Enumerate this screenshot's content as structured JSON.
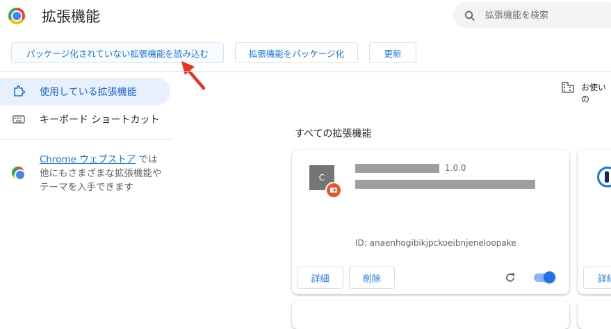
{
  "header": {
    "title": "拡張機能",
    "search_placeholder": "拡張機能を検索"
  },
  "toolbar": {
    "load_unpacked_label": "パッケージ化されていない拡張機能を読み込む",
    "pack_label": "拡張機能をパッケージ化",
    "update_label": "更新"
  },
  "sidebar": {
    "items": [
      {
        "label": "使用している拡張機能",
        "icon": "puzzle-icon",
        "active": true
      },
      {
        "label": "キーボード ショートカット",
        "icon": "keyboard-icon",
        "active": false
      }
    ],
    "store_link": "Chrome ウェブストア",
    "store_suffix": " では他にもさまざまな拡張機能やテーマを入手できます"
  },
  "main": {
    "enterprise_label": "お使いの",
    "section_title": "すべての拡張機能",
    "cards": [
      {
        "icon_letter": "C",
        "version": "1.0.0",
        "id_text": "ID: anaenhogibikjpckoeibnjeneloopake",
        "details_label": "詳細",
        "remove_label": "削除",
        "enabled": true
      },
      {
        "details_label": "詳細"
      }
    ]
  },
  "colors": {
    "accent": "#1a73e8",
    "nav_active_bg": "#e8f0fe",
    "arrow": "#ea3323"
  }
}
